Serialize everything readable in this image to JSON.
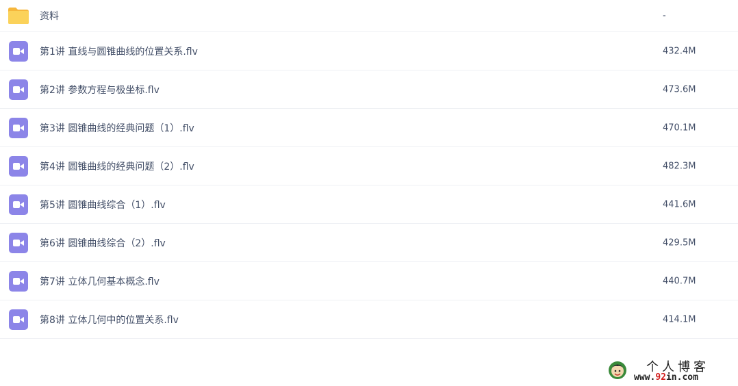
{
  "files": [
    {
      "type": "folder",
      "icon": "folder-icon",
      "name": "资料",
      "size": "-"
    },
    {
      "type": "video",
      "icon": "video-file-icon",
      "name": "第1讲 直线与圆锥曲线的位置关系.flv",
      "size": "432.4M"
    },
    {
      "type": "video",
      "icon": "video-file-icon",
      "name": "第2讲 参数方程与极坐标.flv",
      "size": "473.6M"
    },
    {
      "type": "video",
      "icon": "video-file-icon",
      "name": "第3讲 圆锥曲线的经典问题（1）.flv",
      "size": "470.1M"
    },
    {
      "type": "video",
      "icon": "video-file-icon",
      "name": "第4讲 圆锥曲线的经典问题（2）.flv",
      "size": "482.3M"
    },
    {
      "type": "video",
      "icon": "video-file-icon",
      "name": "第5讲 圆锥曲线综合（1）.flv",
      "size": "441.6M"
    },
    {
      "type": "video",
      "icon": "video-file-icon",
      "name": "第6讲 圆锥曲线综合（2）.flv",
      "size": "429.5M"
    },
    {
      "type": "video",
      "icon": "video-file-icon",
      "name": "第7讲 立体几何基本概念.flv",
      "size": "440.7M"
    },
    {
      "type": "video",
      "icon": "video-file-icon",
      "name": "第8讲 立体几何中的位置关系.flv",
      "size": "414.1M"
    }
  ],
  "watermark": {
    "title": "个人博客",
    "url_prefix": "www.",
    "url_number": "92",
    "url_suffix": "in.com"
  },
  "colors": {
    "folder": "#f9c94a",
    "video_icon": "#8c85e8",
    "text": "#424e67",
    "divider": "#eef0f4"
  }
}
